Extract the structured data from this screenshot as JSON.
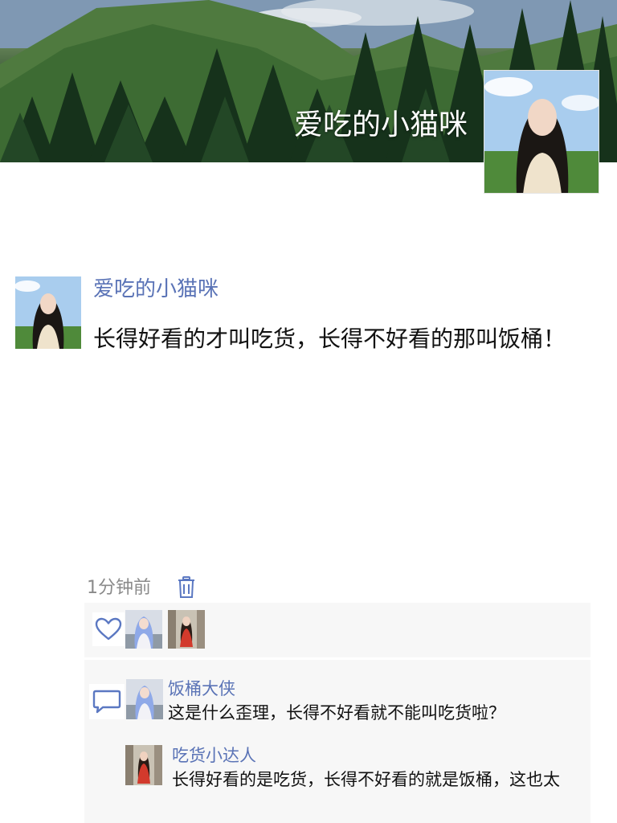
{
  "profile": {
    "cover_name": "爱吃的小猫咪"
  },
  "post": {
    "author": "爱吃的小猫咪",
    "text": "长得好看的才叫吃货，长得不好看的那叫饭桶！",
    "time": "1分钟前"
  },
  "comments": [
    {
      "author": "饭桶大侠",
      "text": "这是什么歪理，长得不好看就不能叫吃货啦？"
    },
    {
      "author": "吃货小达人",
      "text": "长得好看的是吃货，长得不好看的就是饭桶，这也太"
    }
  ],
  "colors": {
    "link_blue": "#5a73b6",
    "panel_bg": "#f7f7f7",
    "icon_blue": "#5b78c2"
  },
  "icons": {
    "delete": "trash-icon",
    "like": "heart-icon",
    "comment": "comment-bubble-icon"
  }
}
